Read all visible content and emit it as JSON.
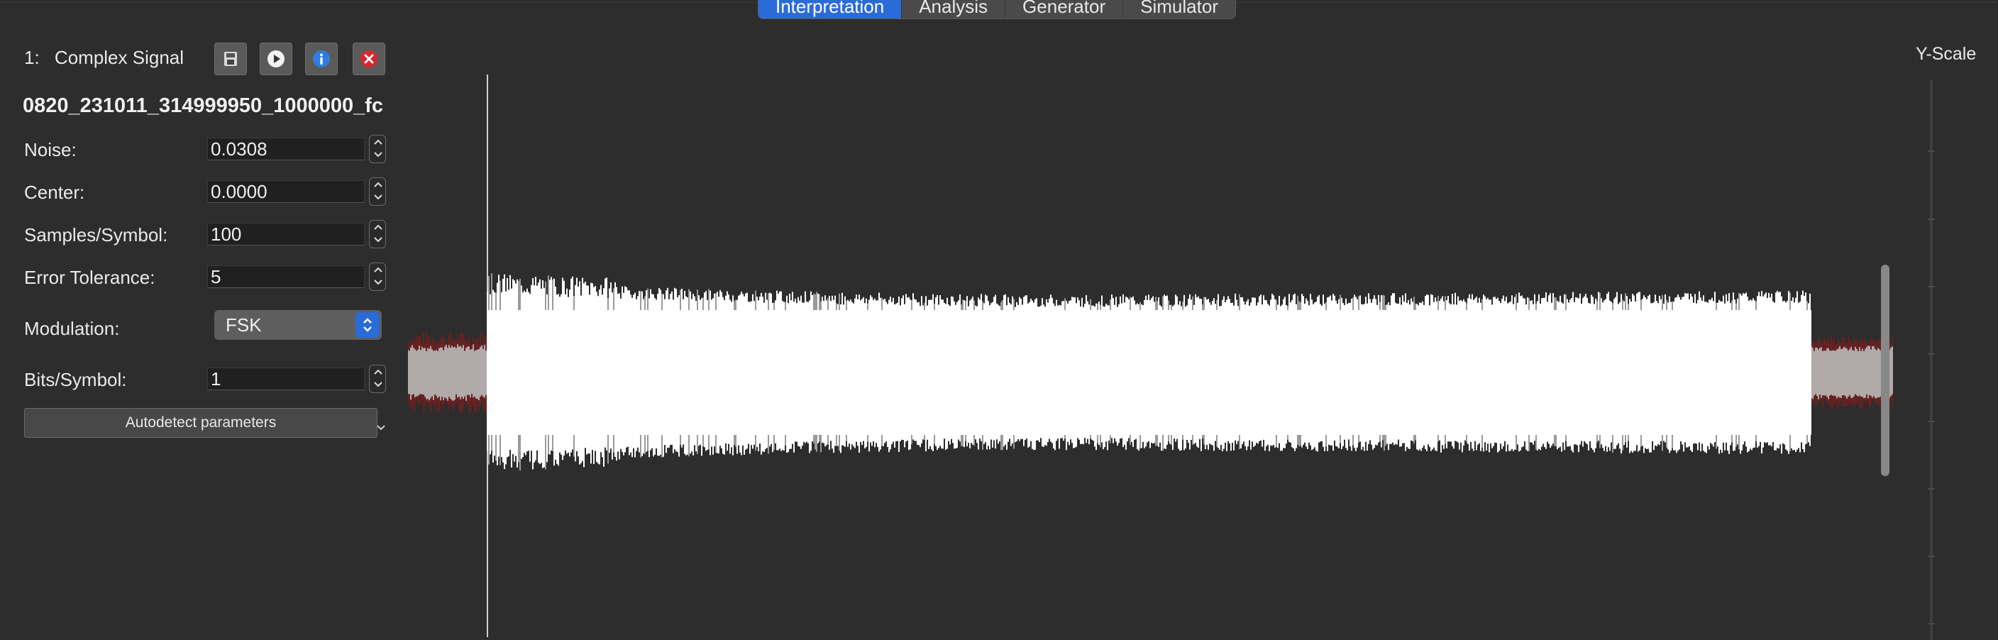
{
  "tabs": [
    {
      "label": "Interpretation",
      "active": true
    },
    {
      "label": "Analysis",
      "active": false
    },
    {
      "label": "Generator",
      "active": false
    },
    {
      "label": "Simulator",
      "active": false
    }
  ],
  "signal": {
    "index": "1:",
    "title": "Complex Signal",
    "filename": "0820_231011_314999950_1000000_fc",
    "toolbar_icons": [
      "save-icon",
      "play-icon",
      "info-icon",
      "close-icon"
    ]
  },
  "fields": {
    "noise": {
      "label": "Noise:",
      "value": "0.0308"
    },
    "center": {
      "label": "Center:",
      "value": "0.0000"
    },
    "samples_per_symbol": {
      "label": "Samples/Symbol:",
      "value": "100"
    },
    "error_tolerance": {
      "label": "Error Tolerance:",
      "value": "5"
    },
    "modulation": {
      "label": "Modulation:",
      "value": "FSK"
    },
    "bits_per_symbol": {
      "label": "Bits/Symbol:",
      "value": "1"
    }
  },
  "autodetect_label": "Autodetect parameters",
  "yscale_label": "Y-Scale",
  "colors": {
    "accent": "#2a6bd8",
    "signal": "#ffffff",
    "signal_edge": "#8b1a1a",
    "background": "#2d2d2d"
  }
}
